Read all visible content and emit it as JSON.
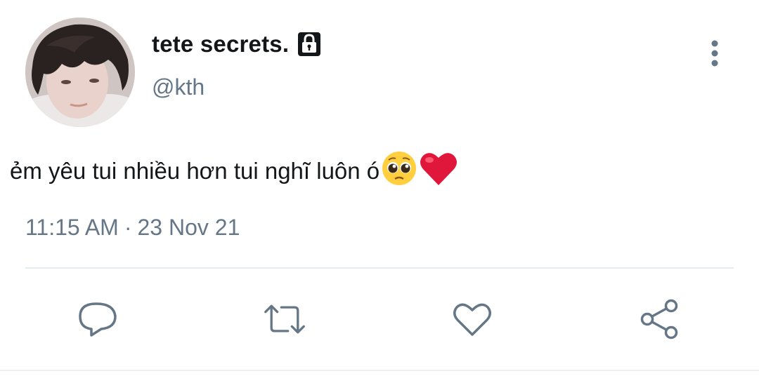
{
  "tweet": {
    "display_name": "tete secrets.",
    "handle": "@kth",
    "text": "ẻm yêu tui nhiều hơn tui nghĩ luôn ó",
    "emojis": [
      "pleading-face",
      "red-heart"
    ],
    "time": "11:15 AM",
    "separator": "·",
    "date": "23 Nov 21",
    "protected": true
  },
  "icons": {
    "lock": "lock-icon",
    "more": "more-vertical-icon",
    "reply": "reply-icon",
    "retweet": "retweet-icon",
    "like": "heart-icon",
    "share": "share-icon"
  },
  "colors": {
    "text_primary": "#14171a",
    "text_secondary": "#657786",
    "icon": "#657786",
    "heart_emoji": "#e0163b"
  }
}
